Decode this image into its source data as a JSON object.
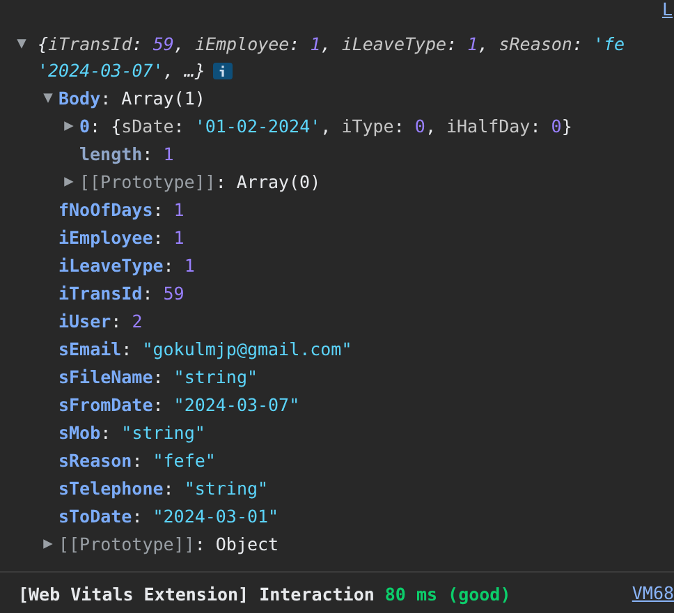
{
  "source_link_top": "L",
  "root": {
    "expanded": true,
    "preview_lines": [
      [
        {
          "text": "{",
          "kind": "punct"
        },
        {
          "text": "iTransId",
          "kind": "key"
        },
        {
          "text": ": ",
          "kind": "punct"
        },
        {
          "text": "59",
          "kind": "number"
        },
        {
          "text": ", ",
          "kind": "punct"
        },
        {
          "text": "iEmployee",
          "kind": "key"
        },
        {
          "text": ": ",
          "kind": "punct"
        },
        {
          "text": "1",
          "kind": "number"
        },
        {
          "text": ", ",
          "kind": "punct"
        },
        {
          "text": "iLeaveType",
          "kind": "key"
        },
        {
          "text": ": ",
          "kind": "punct"
        },
        {
          "text": "1",
          "kind": "number"
        },
        {
          "text": ", ",
          "kind": "punct"
        },
        {
          "text": "sReason",
          "kind": "key"
        },
        {
          "text": ": ",
          "kind": "punct"
        },
        {
          "text": "'fe",
          "kind": "string"
        }
      ],
      [
        {
          "text": "'2024-03-07'",
          "kind": "string"
        },
        {
          "text": ", …}",
          "kind": "punct"
        }
      ]
    ],
    "children": [
      {
        "key": "Body",
        "kind": "own",
        "value": [
          {
            "text": ": ",
            "kind": "punct"
          },
          {
            "text": "Array(1)",
            "kind": "punct"
          }
        ],
        "expanded": true,
        "children": [
          {
            "key": "0",
            "kind": "own",
            "value": [
              {
                "text": ": ",
                "kind": "punct"
              },
              {
                "text": "{",
                "kind": "punct"
              },
              {
                "text": "sDate",
                "kind": "key"
              },
              {
                "text": ": ",
                "kind": "punct"
              },
              {
                "text": "'01-02-2024'",
                "kind": "string"
              },
              {
                "text": ", ",
                "kind": "punct"
              },
              {
                "text": "iType",
                "kind": "key"
              },
              {
                "text": ": ",
                "kind": "punct"
              },
              {
                "text": "0",
                "kind": "number"
              },
              {
                "text": ", ",
                "kind": "punct"
              },
              {
                "text": "iHalfDay",
                "kind": "key"
              },
              {
                "text": ": ",
                "kind": "punct"
              },
              {
                "text": "0",
                "kind": "number"
              },
              {
                "text": "}",
                "kind": "punct"
              }
            ],
            "expanded": false
          },
          {
            "key": "length",
            "kind": "dim",
            "value": [
              {
                "text": ": ",
                "kind": "punct"
              },
              {
                "text": "1",
                "kind": "number"
              }
            ]
          },
          {
            "key": "[[Prototype]]",
            "kind": "internal",
            "value": [
              {
                "text": ": ",
                "kind": "punct"
              },
              {
                "text": "Array(0)",
                "kind": "punct"
              }
            ],
            "expanded": false
          }
        ]
      },
      {
        "key": "fNoOfDays",
        "kind": "own",
        "value": [
          {
            "text": ": ",
            "kind": "punct"
          },
          {
            "text": "1",
            "kind": "number"
          }
        ]
      },
      {
        "key": "iEmployee",
        "kind": "own",
        "value": [
          {
            "text": ": ",
            "kind": "punct"
          },
          {
            "text": "1",
            "kind": "number"
          }
        ]
      },
      {
        "key": "iLeaveType",
        "kind": "own",
        "value": [
          {
            "text": ": ",
            "kind": "punct"
          },
          {
            "text": "1",
            "kind": "number"
          }
        ]
      },
      {
        "key": "iTransId",
        "kind": "own",
        "value": [
          {
            "text": ": ",
            "kind": "punct"
          },
          {
            "text": "59",
            "kind": "number"
          }
        ]
      },
      {
        "key": "iUser",
        "kind": "own",
        "value": [
          {
            "text": ": ",
            "kind": "punct"
          },
          {
            "text": "2",
            "kind": "number"
          }
        ]
      },
      {
        "key": "sEmail",
        "kind": "own",
        "value": [
          {
            "text": ": ",
            "kind": "punct"
          },
          {
            "text": "\"gokulmjp@gmail.com\"",
            "kind": "string"
          }
        ]
      },
      {
        "key": "sFileName",
        "kind": "own",
        "value": [
          {
            "text": ": ",
            "kind": "punct"
          },
          {
            "text": "\"string\"",
            "kind": "string"
          }
        ]
      },
      {
        "key": "sFromDate",
        "kind": "own",
        "value": [
          {
            "text": ": ",
            "kind": "punct"
          },
          {
            "text": "\"2024-03-07\"",
            "kind": "string"
          }
        ]
      },
      {
        "key": "sMob",
        "kind": "own",
        "value": [
          {
            "text": ": ",
            "kind": "punct"
          },
          {
            "text": "\"string\"",
            "kind": "string"
          }
        ]
      },
      {
        "key": "sReason",
        "kind": "own",
        "value": [
          {
            "text": ": ",
            "kind": "punct"
          },
          {
            "text": "\"fefe\"",
            "kind": "string"
          }
        ]
      },
      {
        "key": "sTelephone",
        "kind": "own",
        "value": [
          {
            "text": ": ",
            "kind": "punct"
          },
          {
            "text": "\"string\"",
            "kind": "string"
          }
        ]
      },
      {
        "key": "sToDate",
        "kind": "own",
        "value": [
          {
            "text": ": ",
            "kind": "punct"
          },
          {
            "text": "\"2024-03-01\"",
            "kind": "string"
          }
        ]
      },
      {
        "key": "[[Prototype]]",
        "kind": "internal",
        "value": [
          {
            "text": ": ",
            "kind": "punct"
          },
          {
            "text": "Object",
            "kind": "punct"
          }
        ],
        "expanded": false
      }
    ]
  },
  "message": {
    "segments": [
      {
        "text": "[Web Vitals Extension] Interaction",
        "kind": "plain"
      },
      {
        "text": "80 ms (good)",
        "kind": "good"
      }
    ],
    "source_link": "VM68"
  }
}
